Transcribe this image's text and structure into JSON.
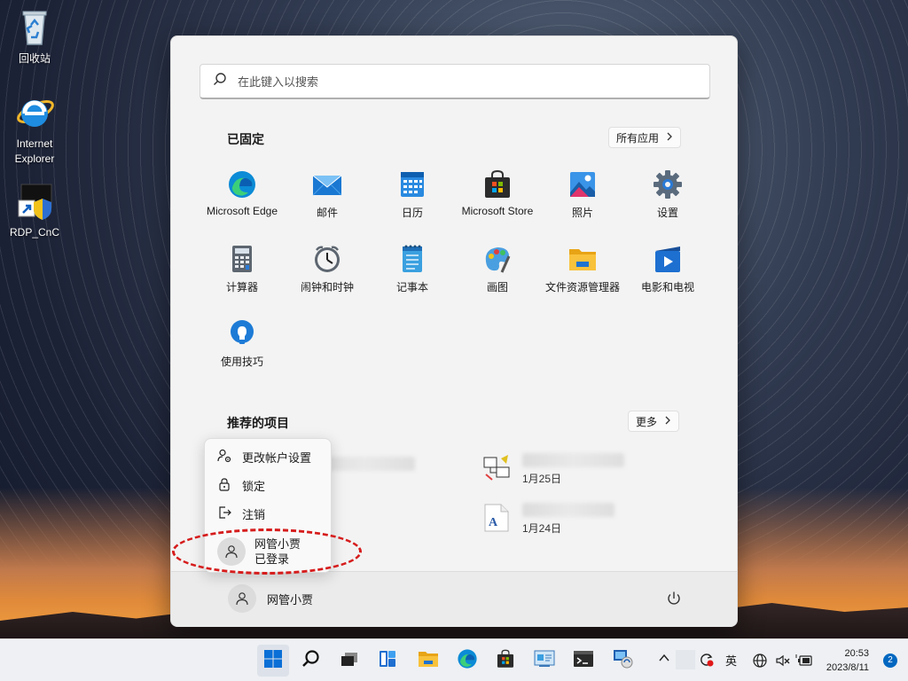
{
  "desktop": {
    "icons": [
      {
        "label": "回收站",
        "icon": "recycle-bin-icon"
      },
      {
        "label": "Internet Explorer",
        "icon": "internet-explorer-icon"
      },
      {
        "label": "RDP_CnC",
        "icon": "rdp-shortcut-icon"
      }
    ]
  },
  "start_menu": {
    "search_placeholder": "在此键入以搜索",
    "pinned_title": "已固定",
    "all_apps_label": "所有应用",
    "pinned_apps": [
      {
        "label": "Microsoft Edge",
        "icon": "edge-icon"
      },
      {
        "label": "邮件",
        "icon": "mail-icon"
      },
      {
        "label": "日历",
        "icon": "calendar-icon"
      },
      {
        "label": "Microsoft Store",
        "icon": "store-icon"
      },
      {
        "label": "照片",
        "icon": "photos-icon"
      },
      {
        "label": "设置",
        "icon": "settings-gear-icon"
      },
      {
        "label": "计算器",
        "icon": "calculator-icon"
      },
      {
        "label": "闹钟和时钟",
        "icon": "alarm-clock-icon"
      },
      {
        "label": "记事本",
        "icon": "notepad-icon"
      },
      {
        "label": "画图",
        "icon": "paint-icon"
      },
      {
        "label": "文件资源管理器",
        "icon": "file-explorer-icon"
      },
      {
        "label": "电影和电视",
        "icon": "movies-tv-icon"
      },
      {
        "label": "使用技巧",
        "icon": "tips-icon"
      }
    ],
    "recommended_title": "推荐的项目",
    "more_label": "更多",
    "recommended": [
      {
        "date": "1月25日"
      },
      {
        "date": "1月24日"
      }
    ],
    "user_name": "网管小贾"
  },
  "account_flyout": {
    "items": [
      {
        "label": "更改帐户设置",
        "icon": "account-settings-icon"
      },
      {
        "label": "锁定",
        "icon": "lock-icon"
      },
      {
        "label": "注销",
        "icon": "sign-out-icon"
      }
    ],
    "user_name": "网管小贾",
    "user_status": "已登录",
    "highlight_color": "#d61c1c"
  },
  "taskbar": {
    "ime_label": "英",
    "time": "20:53",
    "date": "2023/8/11",
    "notification_count": "2",
    "accent": "#0067c0"
  }
}
